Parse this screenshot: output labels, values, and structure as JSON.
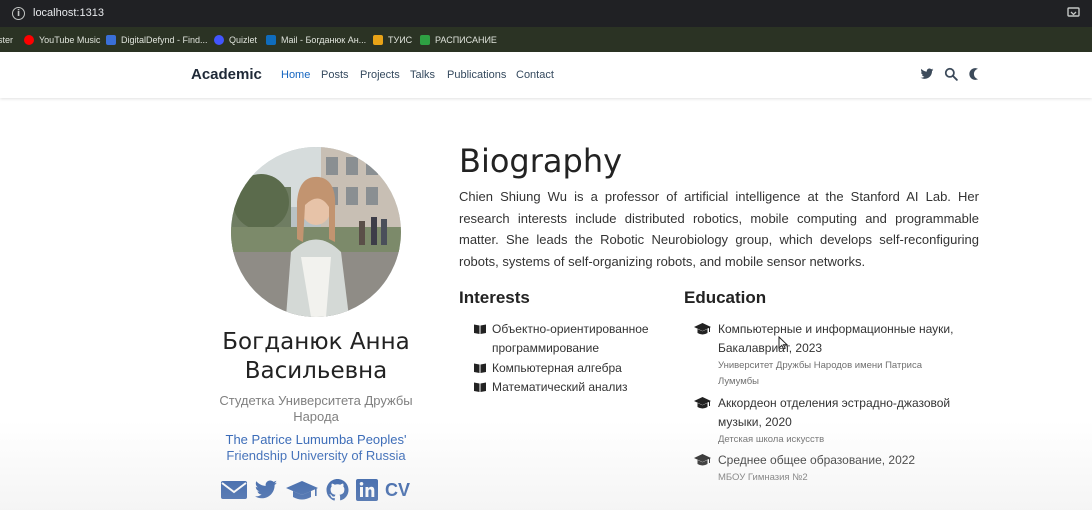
{
  "browser": {
    "url": "localhost:1313",
    "bookmarks": [
      {
        "label": "ster",
        "icon": "bookmark-icon"
      },
      {
        "label": "YouTube Music",
        "icon": "youtube-music-icon"
      },
      {
        "label": "DigitalDefynd - Find...",
        "icon": "digitaldefynd-icon"
      },
      {
        "label": "Quizlet",
        "icon": "quizlet-icon"
      },
      {
        "label": "Mail - Богданюк Ан...",
        "icon": "outlook-icon"
      },
      {
        "label": "ТУИС",
        "icon": "tuis-icon"
      },
      {
        "label": "РАСПИСАНИЕ",
        "icon": "schedule-icon"
      }
    ]
  },
  "navbar": {
    "brand": "Academic",
    "links": [
      "Home",
      "Posts",
      "Projects",
      "Talks",
      "Publications",
      "Contact"
    ],
    "active": "Home",
    "icons": [
      "twitter-icon",
      "search-icon",
      "moon-icon"
    ]
  },
  "profile": {
    "name": "Богданюк Анна Васильевна",
    "role": "Студетка Университета Дружбы Народа",
    "organization": "The Patrice Lumumba Peoples' Friendship University of Russia",
    "social": [
      {
        "icon": "envelope-icon",
        "label": ""
      },
      {
        "icon": "twitter-icon",
        "label": ""
      },
      {
        "icon": "graduation-cap-icon",
        "label": ""
      },
      {
        "icon": "github-icon",
        "label": ""
      },
      {
        "icon": "linkedin-icon",
        "label": ""
      },
      {
        "icon": "cv-icon",
        "label": "CV"
      }
    ]
  },
  "biography": {
    "title": "Biography",
    "text": "Chien Shiung Wu is a professor of artificial intelligence at the Stanford AI Lab. Her research interests include distributed robotics, mobile computing and programmable matter. She leads the Robotic Neurobiology group, which develops self-reconfiguring robots, systems of self-organizing robots, and mobile sensor networks."
  },
  "interests": {
    "title": "Interests",
    "items": [
      "Объектно-ориентированное программирование",
      "Компьютерная алгебра",
      "Математический анализ"
    ]
  },
  "education": {
    "title": "Education",
    "items": [
      {
        "course": "Компьютерные и информационные науки, Бакалавриат, 2023",
        "institution": "Университет Дружбы Народов имени Патриса Лумумбы"
      },
      {
        "course": "Аккордеон отделения эстрадно-джазовой музыки, 2020",
        "institution": "Детская школа искусств"
      },
      {
        "course": "Среднее общее образование, 2022",
        "institution": "МБОУ Гимназия №2"
      }
    ]
  },
  "colors": {
    "accent": "#1565c0",
    "social_icons": "#1e4fa0",
    "browser_toolbar": "#202124",
    "bookmarks_bar": "#2b3324"
  }
}
